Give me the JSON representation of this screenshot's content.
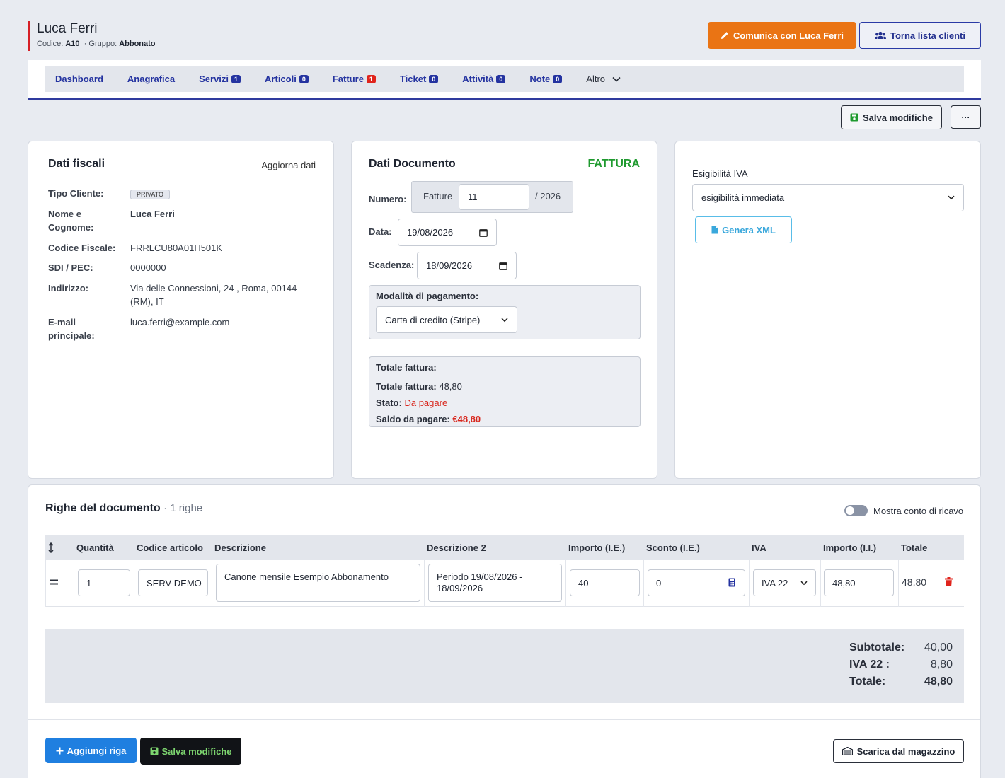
{
  "client": {
    "name": "Luca Ferri",
    "code_label": "Codice:",
    "code": "A10",
    "group_label": "· Gruppo:",
    "group": "Abbonato"
  },
  "header": {
    "contact_button": "Comunica con Luca Ferri",
    "back_button": "Torna lista clienti"
  },
  "tabs": [
    {
      "label": "Dashboard",
      "count": ""
    },
    {
      "label": "Anagrafica",
      "count": ""
    },
    {
      "label": "Servizi",
      "count": "1",
      "color": "#2433a0"
    },
    {
      "label": "Articoli",
      "count": "0",
      "color": "#2433a0"
    },
    {
      "label": "Fatture",
      "count": "1",
      "color": "#e0241c"
    },
    {
      "label": "Ticket",
      "count": "0",
      "color": "#2433a0"
    },
    {
      "label": "Attività",
      "count": "0",
      "color": "#2433a0"
    },
    {
      "label": "Note",
      "count": "0",
      "color": "#2433a0"
    }
  ],
  "tab_more": "Altro",
  "toolbar": {
    "save_label": "Salva modifiche",
    "more_label": "···"
  },
  "fiscal": {
    "title": "Dati fiscali",
    "update_link": "Aggiorna dati",
    "tipo_label": "Tipo Cliente:",
    "tipo": "PRIVATO",
    "nome_label_1": "Nome e",
    "nome_label_2": "Cognome:",
    "nome": "Luca Ferri",
    "cf_label": "Codice Fiscale:",
    "cf": "FRRLCU80A01H501K",
    "sdi_label": "SDI / PEC:",
    "sdi": "0000000",
    "addr_label": "Indirizzo:",
    "addr_1": "Via delle Connessioni, 24 , Roma, 00144",
    "addr_2": "(RM), IT",
    "email_label_1": "E-mail",
    "email_label_2": "principale:",
    "email": "luca.ferri@example.com"
  },
  "document": {
    "title": "Dati Documento",
    "type": "FATTURA",
    "numero_label": "Numero:",
    "numero_prefix": "Fatture",
    "numero": "11",
    "numero_suffix": "/ 2026",
    "data_label": "Data:",
    "data": "19/08/2026",
    "scadenza_label": "Scadenza:",
    "scadenza": "18/09/2026",
    "payment_label": "Modalità di pagamento:",
    "payment": "Carta di credito (Stripe)",
    "totals_title": "Totale fattura:",
    "total_label": "Totale fattura:",
    "total": "48,80",
    "stato_label": "Stato:",
    "stato": "Da pagare",
    "saldo_label": "Saldo da pagare:",
    "saldo": "€48,80"
  },
  "iva_panel": {
    "label": "Esigibilità IVA",
    "value": "esigibilità immediata",
    "xml_button": "Genera XML"
  },
  "lines": {
    "title": "Righe del documento",
    "count_text": "· 1 righe",
    "toggle_label": "Mostra conto di ricavo",
    "columns": [
      "Quantità",
      "Codice articolo",
      "Descrizione",
      "Descrizione 2",
      "Importo (I.E.)",
      "Sconto (I.E.)",
      "IVA",
      "Importo (I.I.)",
      "Totale"
    ],
    "rows": [
      {
        "qty": "1",
        "code": "SERV-DEMO",
        "desc": "Canone mensile Esempio Abbonamento",
        "desc2": "Periodo 19/08/2026 - 18/09/2026",
        "importo": "40",
        "sconto": "0",
        "iva": "IVA 22",
        "importo_ii": "48,80",
        "totale": "48,80"
      }
    ],
    "subtotal_label": "Subtotale:",
    "subtotal": "40,00",
    "iva_label": "IVA 22 :",
    "iva": "8,80",
    "total_label": "Totale:",
    "total": "48,80",
    "add_button": "Aggiungi riga",
    "save_button": "Salva modifiche",
    "warehouse_button": "Scarica dal magazzino"
  }
}
